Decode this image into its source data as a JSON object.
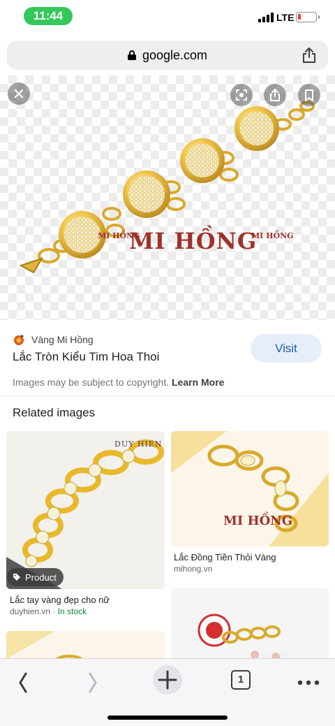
{
  "status_bar": {
    "time": "11:44",
    "network": "LTE",
    "battery_level": 0.1,
    "battery_color": "#ff3b30",
    "time_pill_color": "#34c759"
  },
  "browser": {
    "url": "google.com"
  },
  "image_viewer": {
    "watermark": "MI HỒNG",
    "watermark_small": "MI HỒNG",
    "source_name": "Vàng Mi Hồng",
    "title": "Lắc Tròn Kiểu Tim Hoa Thoi",
    "visit_label": "Visit",
    "copyright_text": "Images may be subject to copyright.",
    "learn_more_label": "Learn More",
    "accent_color": "#1a5fb4"
  },
  "related": {
    "heading": "Related images",
    "cards": [
      {
        "title": "Lắc tay vàng đẹp cho nữ",
        "domain": "duyhien.vn",
        "stock": "In stock",
        "badge": "Product",
        "logo_text": "DUY HIEN"
      },
      {
        "title": "Lắc Đồng Tiền Thỏi Vàng",
        "domain": "mihong.vn",
        "watermark": "MI HỒNG"
      },
      {
        "title": "",
        "domain": ""
      },
      {
        "title": "",
        "domain": ""
      }
    ]
  },
  "toolbar": {
    "tab_count": "1",
    "icons": [
      "back-arrow-icon",
      "forward-arrow-icon",
      "new-tab-plus-icon",
      "tabs-icon",
      "more-icon"
    ]
  }
}
